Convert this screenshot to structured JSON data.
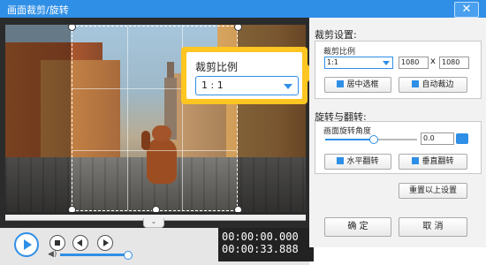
{
  "window": {
    "title": "画面裁剪/旋转",
    "close_glyph": "✕"
  },
  "popup": {
    "label": "裁剪比例",
    "selected": "1 : 1"
  },
  "player": {
    "time_current": "00:00:00.000",
    "time_total": "00:00:33.888",
    "volume_level": 1.0,
    "collapse_glyph": "⌄"
  },
  "crop_settings": {
    "title": "裁剪设置:",
    "ratio_label": "裁剪比例",
    "ratio_value": "1:1",
    "width": "1080",
    "multiply": "x",
    "height": "1080",
    "center_button": "居中选框",
    "auto_button": "自动裁边"
  },
  "rotate_settings": {
    "title": "旋转与翻转:",
    "angle_label": "画面旋转角度",
    "angle_value": "0.0",
    "angle_level": 0.5,
    "flip_h_button": "水平翻转",
    "flip_v_button": "垂直翻转",
    "reset_button": "重置以上设置"
  },
  "footer": {
    "ok_button": "确 定",
    "cancel_button": "取 消"
  },
  "colors": {
    "accent": "#2f8fe6",
    "highlight": "#ffc520"
  }
}
